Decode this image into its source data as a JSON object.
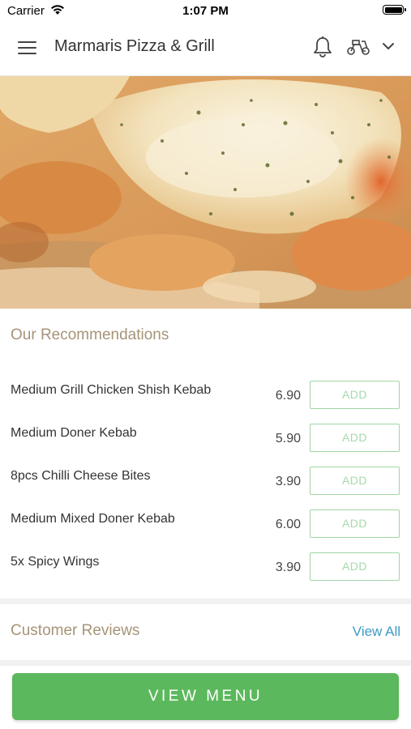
{
  "status_bar": {
    "carrier": "Carrier",
    "time": "1:07 PM"
  },
  "header": {
    "title": "Marmaris Pizza & Grill",
    "icons": [
      "hamburger-menu-icon",
      "bell-icon",
      "scooter-icon",
      "chevron-down-icon"
    ]
  },
  "recommendations": {
    "heading": "Our Recommendations",
    "items": [
      {
        "name": "Medium Grill Chicken Shish Kebab",
        "price": "6.90",
        "button": "ADD"
      },
      {
        "name": "Medium Doner Kebab",
        "price": "5.90",
        "button": "ADD"
      },
      {
        "name": "8pcs Chilli Cheese Bites",
        "price": "3.90",
        "button": "ADD"
      },
      {
        "name": "Medium Mixed Doner Kebab",
        "price": "6.00",
        "button": "ADD"
      },
      {
        "name": "5x Spicy Wings",
        "price": "3.90",
        "button": "ADD"
      }
    ]
  },
  "reviews": {
    "heading": "Customer Reviews",
    "view_all": "View All"
  },
  "footer": {
    "view_menu": "VIEW MENU"
  },
  "colors": {
    "accent_green": "#5cb85c",
    "heading_tan": "#a69478",
    "link_blue": "#3f99c6",
    "add_border": "#9fd6a4"
  }
}
